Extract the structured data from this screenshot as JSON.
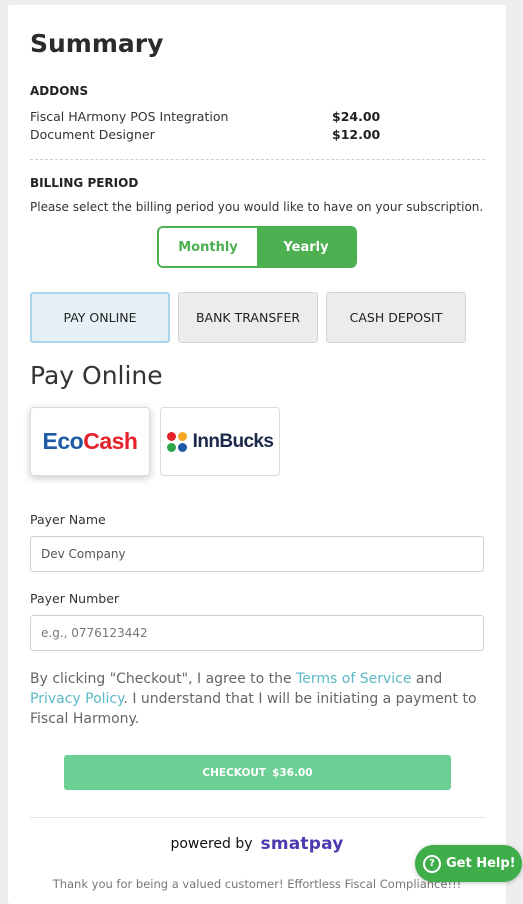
{
  "summary": {
    "title": "Summary"
  },
  "addons": {
    "heading": "ADDONS",
    "items": [
      {
        "name": "Fiscal HArmony POS Integration",
        "price": "$24.00"
      },
      {
        "name": "Document Designer",
        "price": "$12.00"
      }
    ]
  },
  "billing": {
    "heading": "BILLING PERIOD",
    "description": "Please select the billing period you would like to have on your subscription.",
    "options": [
      "Monthly",
      "Yearly"
    ],
    "selected": "Yearly"
  },
  "payment_tabs": {
    "items": [
      "PAY ONLINE",
      "BANK TRANSFER",
      "CASH DEPOSIT"
    ],
    "active": "PAY ONLINE"
  },
  "pay_online": {
    "heading": "Pay Online",
    "providers": [
      {
        "name": "EcoCash",
        "part1": "Eco",
        "part2": "Cash"
      },
      {
        "name": "InnBucks",
        "label": "InnBucks"
      }
    ],
    "selected_provider": "EcoCash"
  },
  "form": {
    "payer_name": {
      "label": "Payer Name",
      "value": "Dev Company"
    },
    "payer_number": {
      "label": "Payer Number",
      "placeholder": "e.g., 0776123442"
    }
  },
  "terms": {
    "prefix": "By clicking \"Checkout\", I agree to the ",
    "tos_link": "Terms of Service",
    "and": " and ",
    "privacy_link": "Privacy Policy",
    "suffix": ". I understand that I will be initiating a payment to Fiscal Harmony."
  },
  "checkout": {
    "label": "CHECKOUT",
    "amount": "$36.00"
  },
  "powered": {
    "text": "powered by",
    "brand": "smatpay"
  },
  "footer": {
    "text": "Thank you for being a valued customer! Effortless Fiscal Compliance!!!"
  },
  "help": {
    "label": "Get Help!",
    "icon": "question-icon"
  },
  "colors": {
    "accent_green": "#4caf50",
    "checkout_green": "#6ccf93",
    "link": "#5bb8c6",
    "brand_purple": "#4b3bb0"
  }
}
